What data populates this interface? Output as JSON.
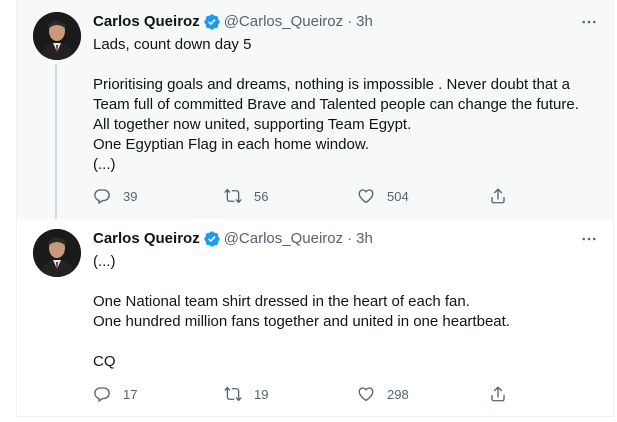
{
  "tweets": [
    {
      "author": {
        "name": "Carlos Queiroz",
        "handle": "@Carlos_Queiroz"
      },
      "separator": "·",
      "time": "3h",
      "lines": [
        "Lads, count down day 5",
        "",
        "Prioritising goals and dreams, nothing is impossible .  Never doubt that a",
        "Team full of committed Brave and Talented people can change the future.",
        "All together now united, supporting Team Egypt.",
        "One Egyptian Flag in each home window.",
        "(...)"
      ],
      "stats": {
        "replies": "39",
        "retweets": "56",
        "likes": "504"
      }
    },
    {
      "author": {
        "name": "Carlos Queiroz",
        "handle": "@Carlos_Queiroz"
      },
      "separator": "·",
      "time": "3h",
      "lines": [
        "(...)",
        "",
        "One National team shirt dressed in the heart of each fan.",
        "One hundred million fans together and united in one heartbeat.",
        "",
        "CQ"
      ],
      "stats": {
        "replies": "17",
        "retweets": "19",
        "likes": "298"
      }
    }
  ],
  "icons": {
    "verified": "verified-badge-icon",
    "more": "more-horizontal-icon",
    "reply": "reply-icon",
    "retweet": "retweet-icon",
    "like": "heart-icon",
    "share": "share-icon"
  },
  "colors": {
    "verified": "#1d9bf0",
    "muted": "#536471",
    "text": "#0f1419",
    "thread_line": "#cfd9de",
    "highlight_bg": "#f7f9f9"
  }
}
